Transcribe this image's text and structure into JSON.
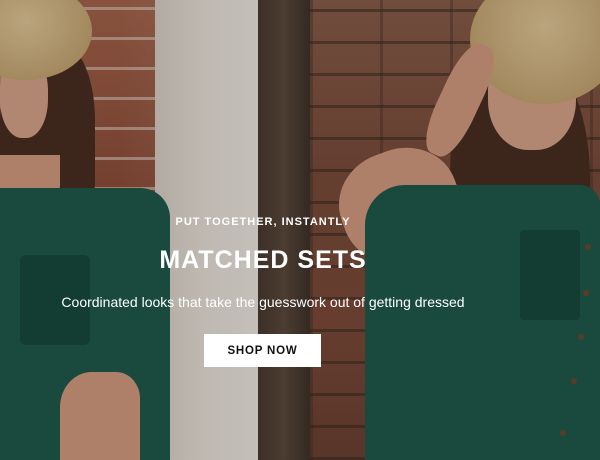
{
  "hero": {
    "eyebrow": "PUT TOGETHER, INSTANTLY",
    "headline": "MATCHED SETS",
    "subtext": "Coordinated looks that take the guesswork out of getting dressed",
    "cta_label": "SHOP NOW"
  },
  "colors": {
    "outfit_green": "#1f5b4b",
    "cta_bg": "#ffffff",
    "text": "#ffffff"
  }
}
